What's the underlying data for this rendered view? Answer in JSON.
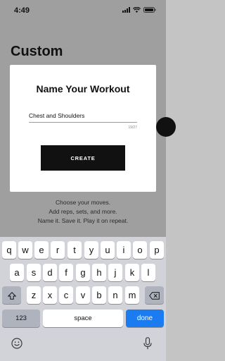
{
  "status_bar": {
    "time": "4:49"
  },
  "background": {
    "page_title": "Custom",
    "hint_lines": [
      "Choose your moves.",
      "Add reps, sets, and more.",
      "Name it. Save it. Play it on repeat."
    ]
  },
  "modal": {
    "title": "Name Your Workout",
    "input_value": "Chest and Shoulders",
    "char_count": "19/27",
    "create_label": "CREATE"
  },
  "keyboard": {
    "row1": [
      "q",
      "w",
      "e",
      "r",
      "t",
      "y",
      "u",
      "i",
      "o",
      "p"
    ],
    "row2": [
      "a",
      "s",
      "d",
      "f",
      "g",
      "h",
      "j",
      "k",
      "l"
    ],
    "row3": [
      "z",
      "x",
      "c",
      "v",
      "b",
      "n",
      "m"
    ],
    "numbers_label": "123",
    "space_label": "space",
    "done_label": "done",
    "shift_icon": "shift-icon",
    "backspace_icon": "backspace-icon",
    "emoji_icon": "emoji-icon",
    "mic_icon": "microphone-icon",
    "accent_color": "#1a7cf0"
  }
}
